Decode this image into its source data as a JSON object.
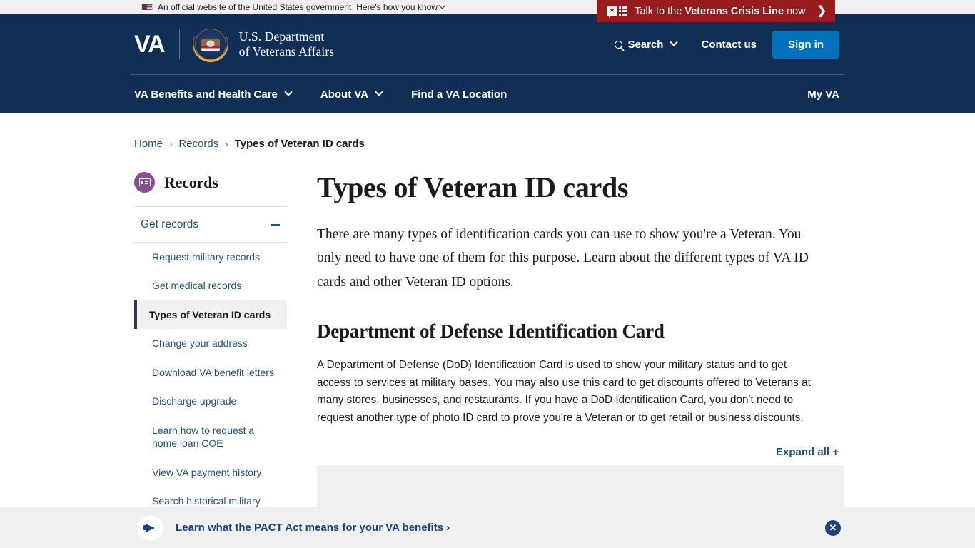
{
  "gov_banner": {
    "text": "An official website of the United States government",
    "link": "Here's how you know",
    "flag_icon": "us-flag-icon",
    "chevron_icon": "chevron-down-icon"
  },
  "crisis_line": {
    "prefix": "Talk to the ",
    "emphasis": "Veterans Crisis Line",
    "suffix": " now",
    "arrow": "❯",
    "bg_color": "#981b1e",
    "icon": "crisis-line-icon"
  },
  "header": {
    "logo_va": "VA",
    "seal_icon": "va-seal-icon",
    "dept_line1": "U.S. Department",
    "dept_line2": "of Veterans Affairs",
    "search_label": "Search",
    "search_icon": "search-icon",
    "contact_label": "Contact us",
    "signin_label": "Sign in",
    "signin_color": "#0071bb",
    "bg_color": "#112f54",
    "nav": [
      {
        "label": "VA Benefits and Health Care",
        "has_chevron": true
      },
      {
        "label": "About VA",
        "has_chevron": true
      },
      {
        "label": "Find a VA Location",
        "has_chevron": false
      }
    ],
    "my_va": "My VA"
  },
  "breadcrumb": {
    "items": [
      {
        "label": "Home",
        "current": false
      },
      {
        "label": "Records",
        "current": false
      },
      {
        "label": "Types of Veteran ID cards",
        "current": true
      }
    ],
    "separator": "›"
  },
  "sidebar": {
    "title": "Records",
    "icon": "records-id-card-icon",
    "icon_color": "#8a4b9e",
    "group": {
      "label": "Get records",
      "collapse_icon": "minus-icon",
      "expanded": true
    },
    "items": [
      {
        "label": "Request military records",
        "active": false
      },
      {
        "label": "Get medical records",
        "active": false
      },
      {
        "label": "Types of Veteran ID cards",
        "active": true
      },
      {
        "label": "Change your address",
        "active": false
      },
      {
        "label": "Download VA benefit letters",
        "active": false
      },
      {
        "label": "Discharge upgrade",
        "active": false
      },
      {
        "label": "Learn how to request a home loan COE",
        "active": false
      },
      {
        "label": "View VA payment history",
        "active": false
      },
      {
        "label": "Search historical military",
        "active": false
      }
    ]
  },
  "main": {
    "title": "Types of Veteran ID cards",
    "intro": "There are many types of identification cards you can use to show you're a Veteran. You only need to have one of them for this purpose. Learn about the different types of VA ID cards and other Veteran ID options.",
    "section_title": "Department of Defense Identification Card",
    "section_body": "A Department of Defense (DoD) Identification Card is used to show your military status and to get access to services at military bases. You may also use this card to get discounts offered to Veterans at many stores, businesses, and restaurants. If you have a DoD Identification Card, you don't need to request another type of photo ID card to prove you're a Veteran or to get retail or business discounts.",
    "expand_all": "Expand all +"
  },
  "promo": {
    "text": "Learn what the PACT Act means for your VA benefits ›",
    "icon": "megaphone-icon",
    "close_icon": "close-icon",
    "close_glyph": "✕",
    "accent_color": "#1a4480"
  }
}
